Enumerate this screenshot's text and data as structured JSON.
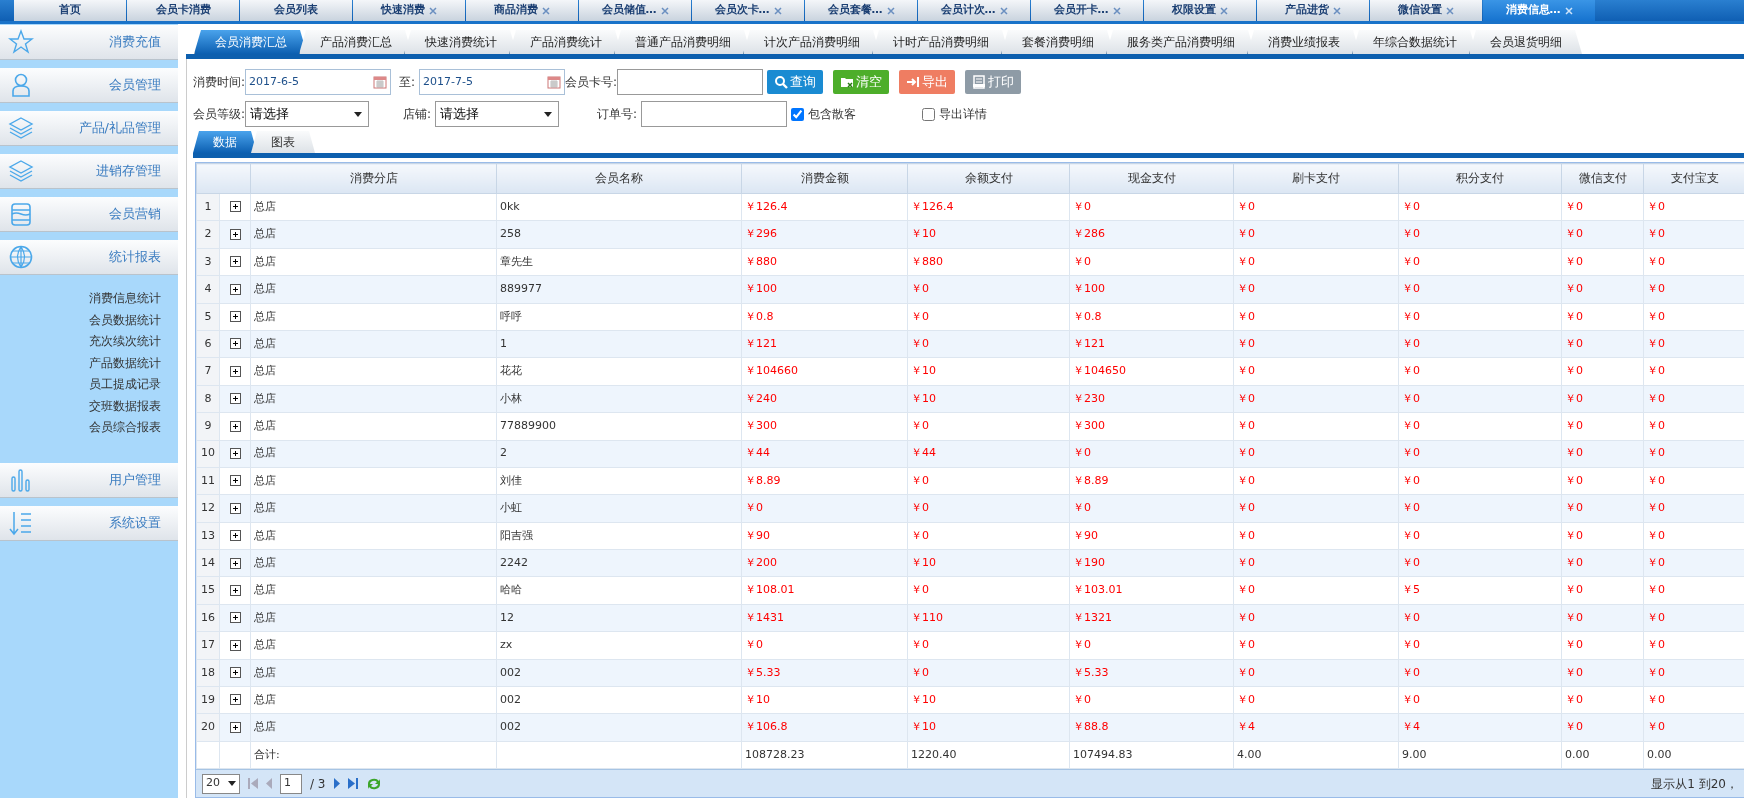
{
  "top_tabs": [
    {
      "label": "首页",
      "closable": false,
      "selected": false
    },
    {
      "label": "会员卡消费",
      "closable": false,
      "selected": false
    },
    {
      "label": "会员列表",
      "closable": false,
      "selected": false
    },
    {
      "label": "快速消费",
      "closable": true,
      "selected": false
    },
    {
      "label": "商品消费",
      "closable": true,
      "selected": false
    },
    {
      "label": "会员储值…",
      "closable": true,
      "selected": false
    },
    {
      "label": "会员次卡…",
      "closable": true,
      "selected": false
    },
    {
      "label": "会员套餐…",
      "closable": true,
      "selected": false
    },
    {
      "label": "会员计次…",
      "closable": true,
      "selected": false
    },
    {
      "label": "会员开卡…",
      "closable": true,
      "selected": false
    },
    {
      "label": "权限设置",
      "closable": true,
      "selected": false
    },
    {
      "label": "产品进货",
      "closable": true,
      "selected": false
    },
    {
      "label": "微信设置",
      "closable": true,
      "selected": false
    },
    {
      "label": "消费信息…",
      "closable": true,
      "selected": true
    }
  ],
  "sidebar": {
    "items": [
      {
        "label": "消费充值",
        "expanded": false
      },
      {
        "label": "会员管理",
        "expanded": false
      },
      {
        "label": "产品/礼品管理",
        "expanded": false
      },
      {
        "label": "进销存管理",
        "expanded": false
      },
      {
        "label": "会员营销",
        "expanded": false
      },
      {
        "label": "统计报表",
        "expanded": true,
        "children": [
          {
            "label": "消费信息统计"
          },
          {
            "label": "会员数据统计"
          },
          {
            "label": "充次续次统计"
          },
          {
            "label": "产品数据统计"
          },
          {
            "label": "员工提成记录"
          },
          {
            "label": "交班数据报表"
          },
          {
            "label": "会员综合报表"
          }
        ]
      },
      {
        "label": "用户管理",
        "expanded": false
      },
      {
        "label": "系统设置",
        "expanded": false
      }
    ]
  },
  "report_tabs": [
    {
      "label": "会员消费汇总",
      "selected": true
    },
    {
      "label": "产品消费汇总",
      "selected": false
    },
    {
      "label": "快速消费统计",
      "selected": false
    },
    {
      "label": "产品消费统计",
      "selected": false
    },
    {
      "label": "普通产品消费明细",
      "selected": false
    },
    {
      "label": "计次产品消费明细",
      "selected": false
    },
    {
      "label": "计时产品消费明细",
      "selected": false
    },
    {
      "label": "套餐消费明细",
      "selected": false
    },
    {
      "label": "服务类产品消费明细",
      "selected": false
    },
    {
      "label": "消费业绩报表",
      "selected": false
    },
    {
      "label": "年综合数据统计",
      "selected": false
    },
    {
      "label": "会员退货明细",
      "selected": false
    }
  ],
  "filters": {
    "time_label": "消费时间:",
    "start_date": "2017-6-5",
    "to_label": "至:",
    "end_date": "2017-7-5",
    "card_label": "会员卡号:",
    "level_label": "会员等级:",
    "level_value": "请选择",
    "store_label": "店铺:",
    "store_value": "请选择",
    "order_label": "订单号:",
    "checkboxes": [
      {
        "label": "包含散客",
        "checked": true
      },
      {
        "label": "导出详情",
        "checked": false
      }
    ],
    "buttons": [
      {
        "label": "查询",
        "kind": "search"
      },
      {
        "label": "清空",
        "kind": "clear"
      },
      {
        "label": "导出",
        "kind": "export"
      },
      {
        "label": "打印",
        "kind": "print"
      }
    ]
  },
  "view_tabs": [
    {
      "label": "数据",
      "selected": true
    },
    {
      "label": "图表",
      "selected": false
    }
  ],
  "table": {
    "columns": [
      "",
      "消费分店",
      "会员名称",
      "消费金额",
      "余额支付",
      "现金支付",
      "刷卡支付",
      "积分支付",
      "微信支付",
      "支付宝支"
    ],
    "rows": [
      [
        "1",
        "总店",
        "0kk",
        "￥126.4",
        "￥126.4",
        "￥0",
        "￥0",
        "￥0",
        "￥0",
        "￥0"
      ],
      [
        "2",
        "总店",
        "258",
        "￥296",
        "￥10",
        "￥286",
        "￥0",
        "￥0",
        "￥0",
        "￥0"
      ],
      [
        "3",
        "总店",
        "章先生",
        "￥880",
        "￥880",
        "￥0",
        "￥0",
        "￥0",
        "￥0",
        "￥0"
      ],
      [
        "4",
        "总店",
        "889977",
        "￥100",
        "￥0",
        "￥100",
        "￥0",
        "￥0",
        "￥0",
        "￥0"
      ],
      [
        "5",
        "总店",
        "呼呼",
        "￥0.8",
        "￥0",
        "￥0.8",
        "￥0",
        "￥0",
        "￥0",
        "￥0"
      ],
      [
        "6",
        "总店",
        "1",
        "￥121",
        "￥0",
        "￥121",
        "￥0",
        "￥0",
        "￥0",
        "￥0"
      ],
      [
        "7",
        "总店",
        "花花",
        "￥104660",
        "￥10",
        "￥104650",
        "￥0",
        "￥0",
        "￥0",
        "￥0"
      ],
      [
        "8",
        "总店",
        "小林",
        "￥240",
        "￥10",
        "￥230",
        "￥0",
        "￥0",
        "￥0",
        "￥0"
      ],
      [
        "9",
        "总店",
        "77889900",
        "￥300",
        "￥0",
        "￥300",
        "￥0",
        "￥0",
        "￥0",
        "￥0"
      ],
      [
        "10",
        "总店",
        "2",
        "￥44",
        "￥44",
        "￥0",
        "￥0",
        "￥0",
        "￥0",
        "￥0"
      ],
      [
        "11",
        "总店",
        "刘佳",
        "￥8.89",
        "￥0",
        "￥8.89",
        "￥0",
        "￥0",
        "￥0",
        "￥0"
      ],
      [
        "12",
        "总店",
        "小虹",
        "￥0",
        "￥0",
        "￥0",
        "￥0",
        "￥0",
        "￥0",
        "￥0"
      ],
      [
        "13",
        "总店",
        "阳吉强",
        "￥90",
        "￥0",
        "￥90",
        "￥0",
        "￥0",
        "￥0",
        "￥0"
      ],
      [
        "14",
        "总店",
        "2242",
        "￥200",
        "￥10",
        "￥190",
        "￥0",
        "￥0",
        "￥0",
        "￥0"
      ],
      [
        "15",
        "总店",
        "哈哈",
        "￥108.01",
        "￥0",
        "￥103.01",
        "￥0",
        "￥5",
        "￥0",
        "￥0"
      ],
      [
        "16",
        "总店",
        "12",
        "￥1431",
        "￥110",
        "￥1321",
        "￥0",
        "￥0",
        "￥0",
        "￥0"
      ],
      [
        "17",
        "总店",
        "zx",
        "￥0",
        "￥0",
        "￥0",
        "￥0",
        "￥0",
        "￥0",
        "￥0"
      ],
      [
        "18",
        "总店",
        "002",
        "￥5.33",
        "￥0",
        "￥5.33",
        "￥0",
        "￥0",
        "￥0",
        "￥0"
      ],
      [
        "19",
        "总店",
        "002",
        "￥10",
        "￥10",
        "￥0",
        "￥0",
        "￥0",
        "￥0",
        "￥0"
      ],
      [
        "20",
        "总店",
        "002",
        "￥106.8",
        "￥10",
        "￥88.8",
        "￥4",
        "￥4",
        "￥0",
        "￥0"
      ]
    ],
    "totals": {
      "label": "合计:",
      "values": [
        "108728.23",
        "1220.40",
        "107494.83",
        "4.00",
        "9.00",
        "0.00",
        "0.00"
      ]
    }
  },
  "pager": {
    "page_size": "20",
    "page": "1",
    "pages": "/ 3",
    "summary": "显示从1 到20，"
  }
}
